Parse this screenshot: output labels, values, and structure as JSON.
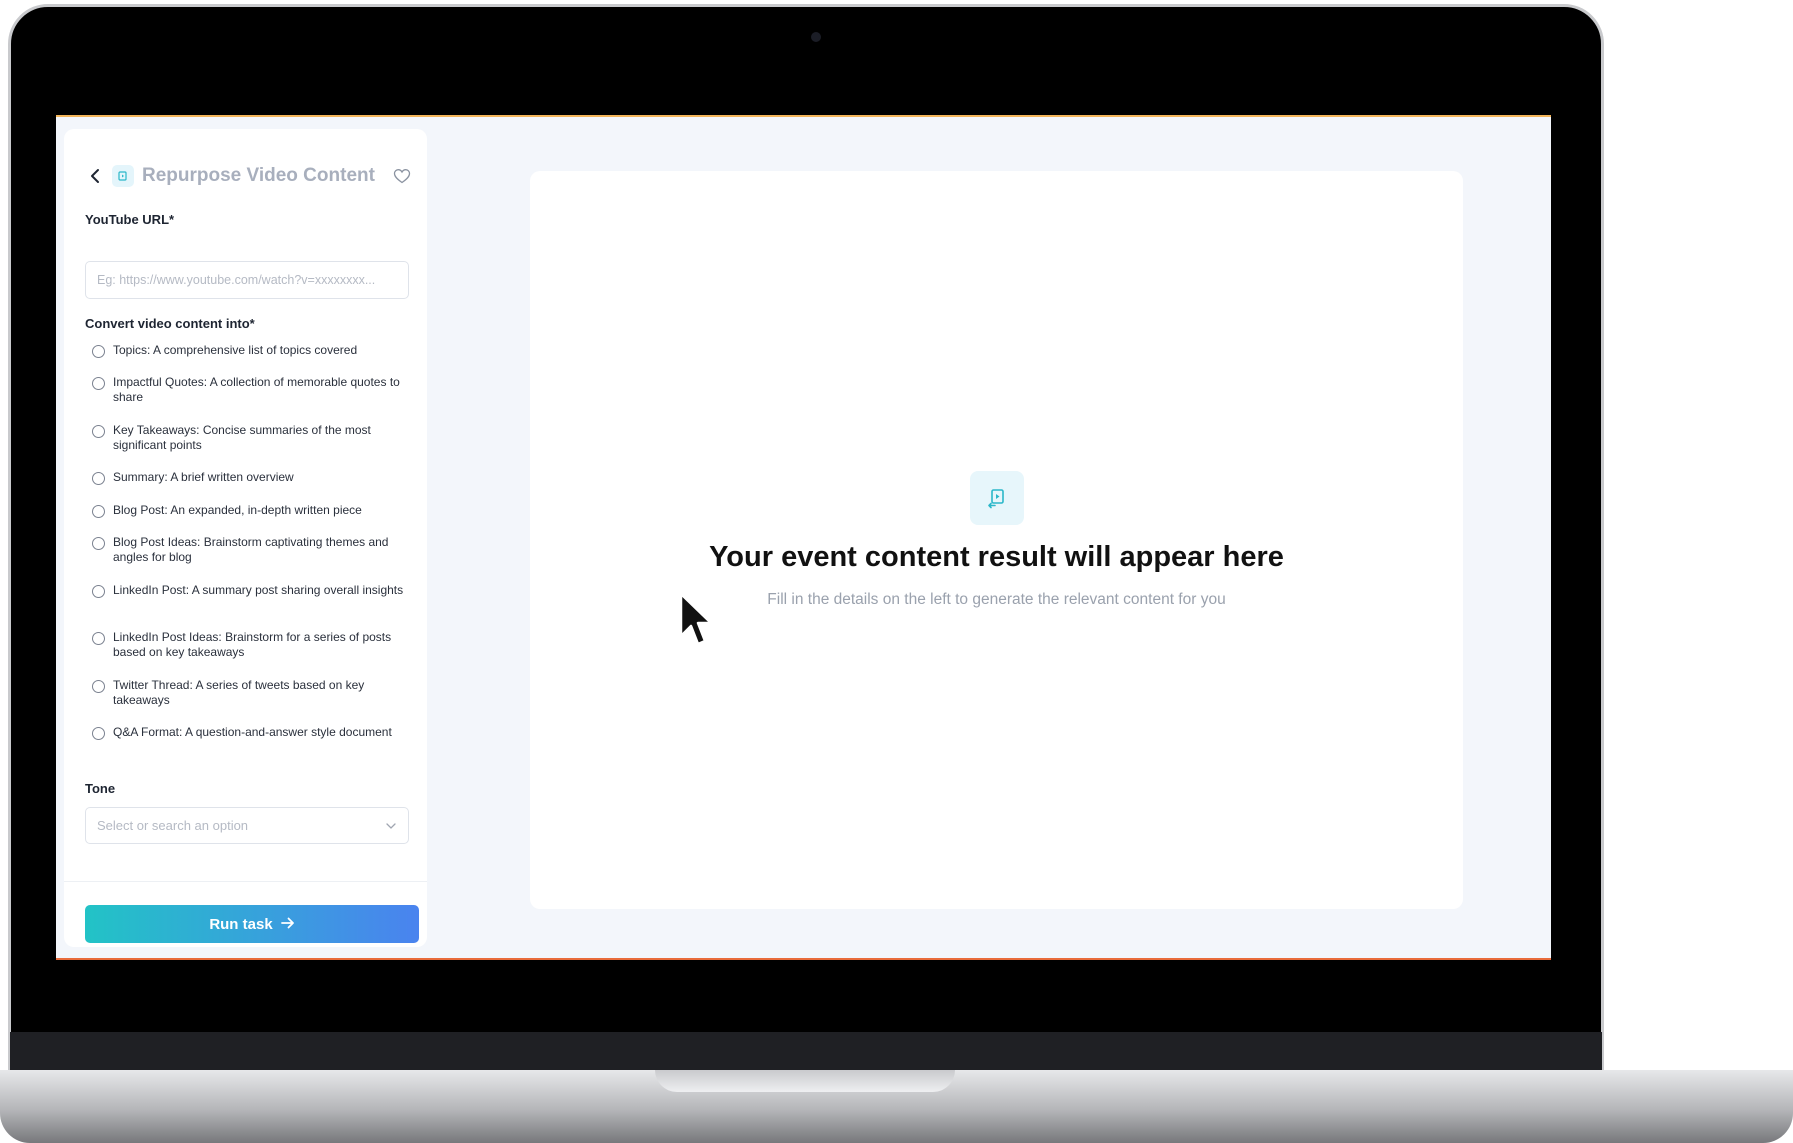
{
  "panel": {
    "title": "Repurpose Video Content",
    "youtube_label": "YouTube URL*",
    "youtube_placeholder": "Eg: https://www.youtube.com/watch?v=xxxxxxxx...",
    "convert_label": "Convert video content into*",
    "options": [
      "Topics: A comprehensive list of topics covered",
      "Impactful Quotes: A collection of memorable quotes to share",
      "Key Takeaways: Concise summaries of the most significant points",
      "Summary: A brief written overview",
      "Blog Post: An expanded, in-depth written piece",
      "Blog Post Ideas: Brainstorm captivating themes and angles for blog",
      "LinkedIn Post: A summary post sharing overall insights",
      "LinkedIn Post Ideas: Brainstorm for a series of posts based on key takeaways",
      "Twitter Thread: A series of tweets based on key takeaways",
      "Q&A Format: A question-and-answer style document"
    ],
    "tone_label": "Tone",
    "tone_placeholder": "Select or search an option",
    "run_label": "Run task"
  },
  "result": {
    "title": "Your event content result will appear here",
    "subtitle": "Fill in the details on the left to generate the relevant content for you"
  },
  "colors": {
    "accent_start": "#22c3c6",
    "accent_end": "#4a83ef",
    "icon_teal": "#2bb7c9"
  }
}
